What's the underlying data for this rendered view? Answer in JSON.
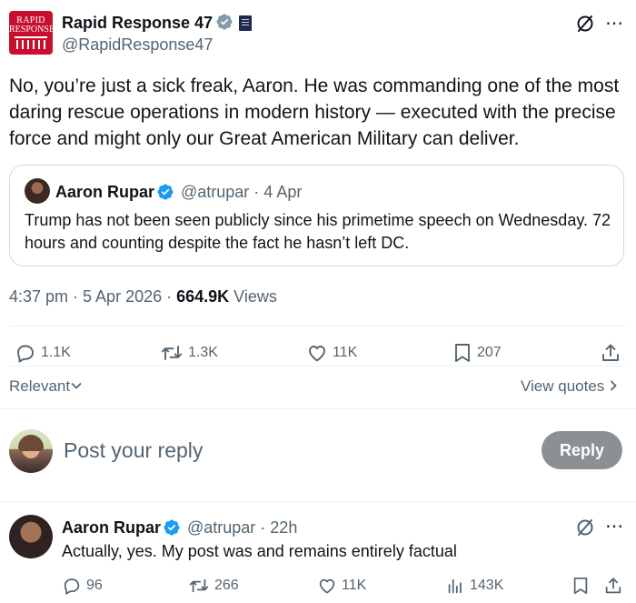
{
  "post": {
    "author_name": "Rapid Response 47",
    "author_handle": "@RapidResponse47",
    "avatar_text_line1": "RAPID",
    "avatar_text_line2": "RESPONSE",
    "body": "No, you’re just a sick freak, Aaron. He was commanding one of the most daring rescue operations in modern history — executed with the precise force and might only our Great American Military can deliver.",
    "quote": {
      "author_name": "Aaron Rupar",
      "meta": "@atrupar · 4 Apr",
      "text": "Trump has not been seen publicly since his primetime speech on Wednesday. 72 hours and counting despite the fact he hasn’t left DC."
    },
    "time_date": "4:37 pm · 5 Apr 2026 · ",
    "views_count": "664.9K",
    "views_label": " Views",
    "stats": {
      "replies": "1.1K",
      "reposts": "1.3K",
      "likes": "11K",
      "bookmarks": "207"
    }
  },
  "sort": {
    "label": "Relevant",
    "view_quotes": "View quotes"
  },
  "composer": {
    "placeholder": "Post your reply",
    "button_label": "Reply"
  },
  "reply": {
    "author_name": "Aaron Rupar",
    "meta": "@atrupar · 22h",
    "text": "Actually, yes. My post was and remains entirely factual",
    "stats": {
      "replies": "96",
      "reposts": "266",
      "likes": "11K",
      "views": "143K"
    }
  },
  "colors": {
    "verified_blue": "#1d9bf0",
    "verified_grey": "#829aab",
    "muted_text": "#536471",
    "reply_button_bg": "#8b9093",
    "brand_red": "#c8102e"
  },
  "icons": [
    "verified-icon",
    "government-flag-icon",
    "grok-icon",
    "more-icon",
    "reply-icon",
    "repost-icon",
    "like-icon",
    "bookmark-icon",
    "share-icon",
    "views-icon",
    "chevron-down-icon",
    "chevron-right-icon"
  ]
}
